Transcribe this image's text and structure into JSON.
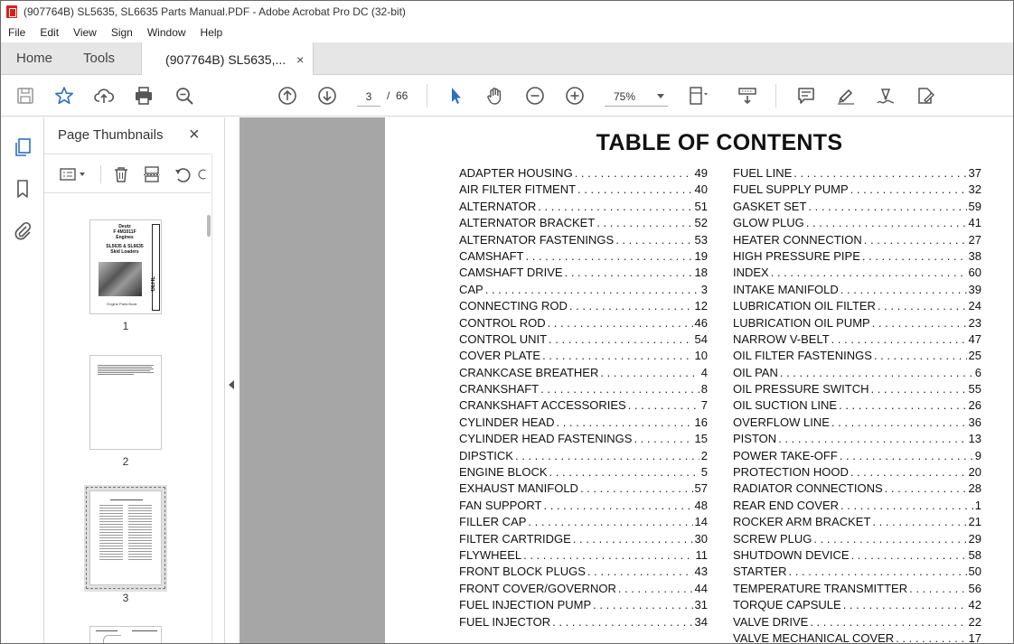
{
  "window": {
    "title": "(907764B) SL5635, SL6635 Parts Manual.PDF - Adobe Acrobat Pro DC (32-bit)"
  },
  "menu": [
    "File",
    "Edit",
    "View",
    "Sign",
    "Window",
    "Help"
  ],
  "tabs": {
    "home": "Home",
    "tools": "Tools",
    "document": "(907764B) SL5635,...",
    "close": "×"
  },
  "toolbar": {
    "current_page": "3",
    "page_slash": "/",
    "total_pages": "66",
    "zoom": "75%"
  },
  "thumbnails_panel": {
    "title": "Page Thumbnails",
    "close": "×",
    "pages": [
      {
        "number": "1",
        "cover_lines": [
          "Deutz",
          "F 4M1011F",
          "Engines",
          "SL5635 & SL6635",
          "Skid Loaders",
          "Engine Parts Book"
        ],
        "brand": "GEHL"
      },
      {
        "number": "2"
      },
      {
        "number": "3",
        "selected": true
      }
    ]
  },
  "toc": {
    "title": "TABLE OF CONTENTS",
    "left": [
      {
        "label": "ADAPTER HOUSING",
        "page": "49"
      },
      {
        "label": "AIR FILTER FITMENT",
        "page": "40"
      },
      {
        "label": "ALTERNATOR",
        "page": "51"
      },
      {
        "label": "ALTERNATOR BRACKET",
        "page": "52"
      },
      {
        "label": "ALTERNATOR FASTENINGS",
        "page": "53"
      },
      {
        "label": "CAMSHAFT",
        "page": "19"
      },
      {
        "label": "CAMSHAFT DRIVE",
        "page": "18"
      },
      {
        "label": "CAP",
        "page": "3"
      },
      {
        "label": "CONNECTING ROD",
        "page": "12"
      },
      {
        "label": "CONTROL ROD",
        "page": "46"
      },
      {
        "label": "CONTROL UNIT",
        "page": "54"
      },
      {
        "label": "COVER PLATE",
        "page": "10"
      },
      {
        "label": "CRANKCASE BREATHER",
        "page": "4"
      },
      {
        "label": "CRANKSHAFT",
        "page": "8"
      },
      {
        "label": "CRANKSHAFT ACCESSORIES",
        "page": "7"
      },
      {
        "label": "CYLINDER HEAD",
        "page": "16"
      },
      {
        "label": "CYLINDER HEAD FASTENINGS",
        "page": "15"
      },
      {
        "label": "DIPSTICK",
        "page": "2"
      },
      {
        "label": "ENGINE BLOCK",
        "page": "5"
      },
      {
        "label": "EXHAUST MANIFOLD",
        "page": "57"
      },
      {
        "label": "FAN SUPPORT",
        "page": "48"
      },
      {
        "label": "FILLER CAP",
        "page": "14"
      },
      {
        "label": "FILTER CARTRIDGE",
        "page": "30"
      },
      {
        "label": "FLYWHEEL",
        "page": "11"
      },
      {
        "label": "FRONT BLOCK PLUGS",
        "page": "43"
      },
      {
        "label": "FRONT COVER/GOVERNOR",
        "page": "44"
      },
      {
        "label": "FUEL INJECTION PUMP",
        "page": "31"
      },
      {
        "label": "FUEL INJECTOR",
        "page": "34"
      }
    ],
    "right": [
      {
        "label": "FUEL LINE",
        "page": "37"
      },
      {
        "label": "FUEL SUPPLY PUMP",
        "page": "32"
      },
      {
        "label": "GASKET SET",
        "page": "59"
      },
      {
        "label": "GLOW PLUG",
        "page": "41"
      },
      {
        "label": "HEATER CONNECTION",
        "page": "27"
      },
      {
        "label": "HIGH PRESSURE PIPE",
        "page": "38"
      },
      {
        "label": "INDEX",
        "page": "60"
      },
      {
        "label": "INTAKE MANIFOLD",
        "page": "39"
      },
      {
        "label": "LUBRICATION OIL FILTER",
        "page": "24"
      },
      {
        "label": "LUBRICATION OIL PUMP",
        "page": "23"
      },
      {
        "label": "NARROW V-BELT",
        "page": "47"
      },
      {
        "label": "OIL FILTER FASTENINGS",
        "page": "25"
      },
      {
        "label": "OIL PAN",
        "page": "6"
      },
      {
        "label": "OIL PRESSURE SWITCH",
        "page": "55"
      },
      {
        "label": "OIL SUCTION LINE",
        "page": "26"
      },
      {
        "label": "OVERFLOW LINE",
        "page": "36"
      },
      {
        "label": "PISTON",
        "page": "13"
      },
      {
        "label": "POWER TAKE-OFF",
        "page": "9"
      },
      {
        "label": "PROTECTION HOOD",
        "page": "20"
      },
      {
        "label": "RADIATOR CONNECTIONS",
        "page": "28"
      },
      {
        "label": "REAR END COVER",
        "page": "1"
      },
      {
        "label": "ROCKER ARM BRACKET",
        "page": "21"
      },
      {
        "label": "SCREW PLUG",
        "page": "29"
      },
      {
        "label": "SHUTDOWN DEVICE",
        "page": "58"
      },
      {
        "label": "STARTER",
        "page": "50"
      },
      {
        "label": "TEMPERATURE TRANSMITTER",
        "page": "56"
      },
      {
        "label": "TORQUE CAPSULE",
        "page": "42"
      },
      {
        "label": "VALVE DRIVE",
        "page": "22"
      },
      {
        "label": "VALVE MECHANICAL COVER",
        "page": "17"
      }
    ]
  },
  "colors": {
    "accent": "#2d6fc4",
    "acrobat_red": "#d8201c",
    "gutter": "#a6a6a6"
  }
}
